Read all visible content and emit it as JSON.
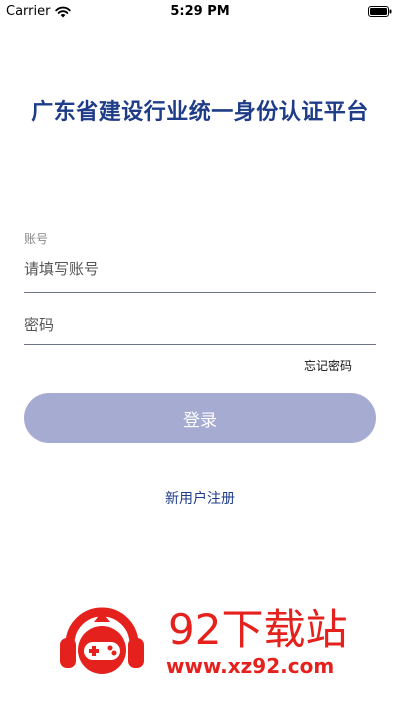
{
  "status_bar": {
    "carrier": "Carrier",
    "time": "5:29 PM"
  },
  "app": {
    "title": "广东省建设行业统一身份认证平台"
  },
  "form": {
    "account_label": "账号",
    "account_placeholder": "请填写账号",
    "password_placeholder": "密码",
    "forgot_password": "忘记密码",
    "login_button": "登录",
    "register": "新用户注册"
  },
  "watermark": {
    "brand": "92下载站",
    "url": "www.xz92.com"
  },
  "colors": {
    "title": "#1f3c88",
    "button_bg": "#a6abd2",
    "watermark": "#e5211d"
  },
  "icons": {
    "wifi": "wifi-icon",
    "battery": "battery-icon",
    "logo": "gamepad-headphones-logo"
  }
}
